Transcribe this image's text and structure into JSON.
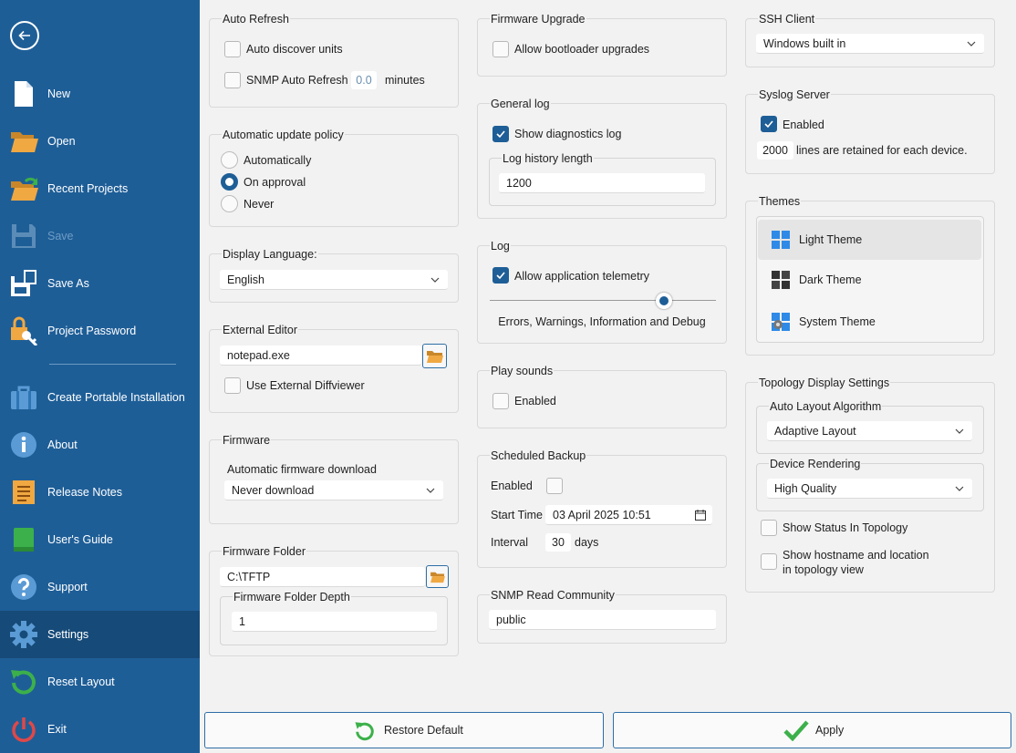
{
  "sidebar": {
    "items": [
      {
        "label": "New",
        "icon": "new-file-icon"
      },
      {
        "label": "Open",
        "icon": "open-folder-icon"
      },
      {
        "label": "Recent Projects",
        "icon": "recent-projects-icon"
      },
      {
        "label": "Save",
        "icon": "save-icon"
      },
      {
        "label": "Save As",
        "icon": "save-as-icon"
      },
      {
        "label": "Project Password",
        "icon": "project-password-icon"
      },
      {
        "label": "Create Portable Installation",
        "icon": "portable-installation-icon"
      },
      {
        "label": "About",
        "icon": "info-icon"
      },
      {
        "label": "Release Notes",
        "icon": "release-notes-icon"
      },
      {
        "label": "User's Guide",
        "icon": "users-guide-icon"
      },
      {
        "label": "Support",
        "icon": "help-icon"
      },
      {
        "label": "Settings",
        "icon": "gear-icon"
      },
      {
        "label": "Reset Layout",
        "icon": "reset-icon"
      },
      {
        "label": "Exit",
        "icon": "power-icon"
      }
    ]
  },
  "auto_refresh": {
    "title": "Auto Refresh",
    "discover_label": "Auto discover units",
    "snmp_label": "SNMP Auto Refresh",
    "snmp_value": "0.0",
    "minutes_label": "minutes"
  },
  "update_policy": {
    "title": "Automatic update policy",
    "options": [
      "Automatically",
      "On approval",
      "Never"
    ],
    "selected": "On approval"
  },
  "language": {
    "title": "Display Language:",
    "value": "English"
  },
  "external_editor": {
    "title": "External Editor",
    "value": "notepad.exe",
    "diff_label": "Use External Diffviewer"
  },
  "firmware": {
    "title": "Firmware",
    "download_label": "Automatic firmware download",
    "download_value": "Never download"
  },
  "firmware_folder": {
    "title": "Firmware Folder",
    "value": "C:\\TFTP",
    "depth_title": "Firmware Folder Depth",
    "depth_value": "1"
  },
  "firmware_upgrade": {
    "title": "Firmware Upgrade",
    "bootloader_label": "Allow bootloader upgrades"
  },
  "general_log": {
    "title": "General log",
    "diag_label": "Show diagnostics log",
    "diag_checked": true,
    "history_title": "Log history length",
    "history_value": "1200"
  },
  "log": {
    "title": "Log",
    "telemetry_label": "Allow application telemetry",
    "telemetry_checked": true,
    "level_text": "Errors, Warnings, Information and Debug"
  },
  "play_sounds": {
    "title": "Play sounds",
    "enabled_label": "Enabled"
  },
  "scheduled_backup": {
    "title": "Scheduled Backup",
    "enabled_label": "Enabled",
    "start_label": "Start Time",
    "start_value": "03 April 2025 10:51",
    "interval_label": "Interval",
    "interval_value": "30",
    "days_label": "days"
  },
  "snmp_community": {
    "title": "SNMP Read Community",
    "value": "public"
  },
  "ssh": {
    "title": "SSH Client",
    "value": "Windows built in"
  },
  "syslog": {
    "title": "Syslog Server",
    "enabled_label": "Enabled",
    "enabled_checked": true,
    "lines_value": "2000",
    "lines_label": "lines are retained for each device."
  },
  "themes": {
    "title": "Themes",
    "options": [
      "Light Theme",
      "Dark Theme",
      "System Theme"
    ],
    "selected": "Light Theme"
  },
  "topology": {
    "title": "Topology Display Settings",
    "layout_title": "Auto Layout Algorithm",
    "layout_value": "Adaptive Layout",
    "render_title": "Device Rendering",
    "render_value": "High Quality",
    "status_label": "Show Status In Topology",
    "hostname_line1": "Show hostname and location",
    "hostname_line2": "in topology view"
  },
  "footer": {
    "restore_label": "Restore Default",
    "apply_label": "Apply"
  },
  "colors": {
    "sidebar": "#1e5e97",
    "sidebar_active": "#164a78",
    "accent": "#1e5e97",
    "background": "#f2f2f2"
  }
}
